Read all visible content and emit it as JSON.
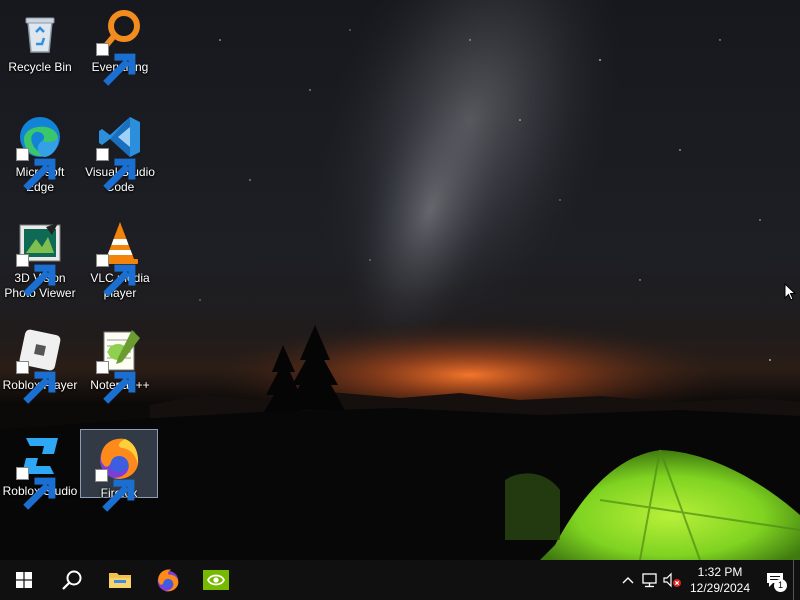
{
  "desktop": {
    "icons": [
      {
        "label": "Recycle Bin",
        "icon": "recycle-bin-icon"
      },
      {
        "label": "Everything",
        "icon": "everything-search-icon"
      },
      {
        "label": "Microsoft Edge",
        "icon": "edge-icon"
      },
      {
        "label": "Visual Studio Code",
        "icon": "vscode-icon"
      },
      {
        "label": "3D Vision Photo Viewer",
        "icon": "3d-vision-icon"
      },
      {
        "label": "VLC media player",
        "icon": "vlc-icon"
      },
      {
        "label": "Roblox Player",
        "icon": "roblox-player-icon"
      },
      {
        "label": "Notepad++",
        "icon": "notepad-plus-plus-icon"
      },
      {
        "label": "Roblox Studio",
        "icon": "roblox-studio-icon"
      },
      {
        "label": "Firefox",
        "icon": "firefox-icon",
        "selected": true
      }
    ]
  },
  "taskbar": {
    "buttons": [
      {
        "name": "start",
        "icon": "windows-logo-icon"
      },
      {
        "name": "search",
        "icon": "search-icon"
      },
      {
        "name": "file-explorer",
        "icon": "folder-icon"
      },
      {
        "name": "firefox",
        "icon": "firefox-icon"
      },
      {
        "name": "nvidia",
        "icon": "nvidia-icon"
      }
    ],
    "tray": {
      "icons": [
        "chevron-up-icon",
        "network-icon",
        "volume-muted-icon"
      ],
      "time": "1:32 PM",
      "date": "12/29/2024",
      "notification_count": "1"
    }
  },
  "colors": {
    "taskbar": "#101010",
    "tent": "#7fd321",
    "sunset_glow": "#e4692a",
    "selection": "#a0bee6"
  }
}
